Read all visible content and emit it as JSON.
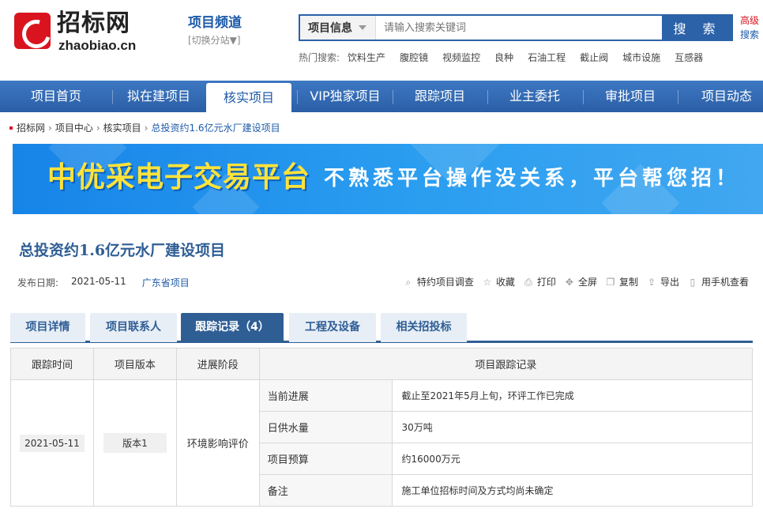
{
  "header": {
    "logo_cn": "招标网",
    "logo_en": "zhaobiao.cn",
    "channel_title": "项目频道",
    "channel_switch": "[切换分站▼]",
    "search": {
      "category": "项目信息",
      "placeholder": "请输入搜索关键词",
      "button": "搜 索"
    },
    "advanced_1": "高级",
    "advanced_2": "搜索",
    "hot_label": "热门搜索:",
    "hot_items": [
      "饮料生产",
      "腹腔镜",
      "视频监控",
      "良种",
      "石油工程",
      "截止阀",
      "城市设施",
      "互感器"
    ]
  },
  "nav": {
    "items": [
      "项目首页",
      "拟在建项目",
      "核实项目",
      "VIP独家项目",
      "跟踪项目",
      "业主委托",
      "审批项目",
      "项目动态"
    ],
    "active": "核实项目"
  },
  "breadcrumb": [
    "招标网",
    "项目中心",
    "核实项目",
    "总投资约1.6亿元水厂建设项目"
  ],
  "banner": {
    "title": "中优采电子交易平台",
    "slogan": "不熟悉平台操作没关系，平台帮您招！"
  },
  "project": {
    "title": "总投资约1.6亿元水厂建设项目",
    "date_label": "发布日期:",
    "date": "2021-05-11",
    "region": "广东省项目"
  },
  "tools": [
    "特约项目调查",
    "收藏",
    "打印",
    "全屏",
    "复制",
    "导出",
    "用手机查看"
  ],
  "tabs": [
    "项目详情",
    "项目联系人",
    "跟踪记录（4）",
    "工程及设备",
    "相关招投标"
  ],
  "table": {
    "headers": [
      "跟踪时间",
      "项目版本",
      "进展阶段",
      "项目跟踪记录"
    ],
    "track_time": "2021-05-11",
    "version": "版本1",
    "stage": "环境影响评价",
    "records": [
      {
        "label": "当前进展",
        "value": "截止至2021年5月上旬，环评工作已完成"
      },
      {
        "label": "日供水量",
        "value": "30万吨"
      },
      {
        "label": "项目预算",
        "value": "约16000万元"
      },
      {
        "label": "备注",
        "value": "施工单位招标时间及方式均尚未确定"
      }
    ]
  }
}
